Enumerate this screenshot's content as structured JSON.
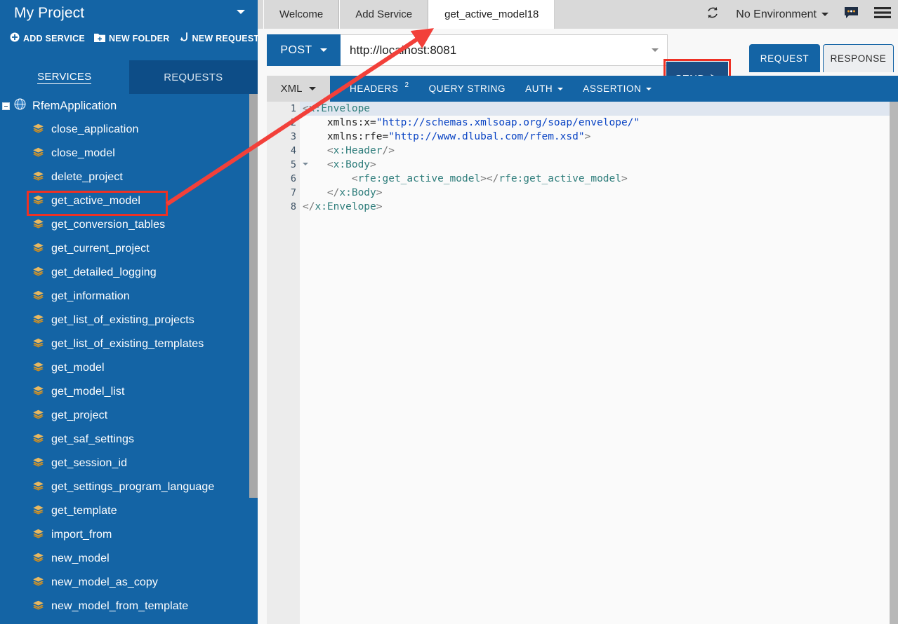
{
  "sidebar": {
    "project_title": "My Project",
    "actions": [
      {
        "label": "ADD SERVICE",
        "icon": "plus-circle-icon"
      },
      {
        "label": "NEW FOLDER",
        "icon": "folder-plus-icon"
      },
      {
        "label": "NEW REQUEST",
        "icon": "new-request-icon"
      }
    ],
    "tabs": [
      {
        "label": "SERVICES",
        "active": true
      },
      {
        "label": "REQUESTS",
        "active": false
      }
    ],
    "tree_root": {
      "label": "RfemApplication",
      "icon": "globe-icon",
      "expanded": true
    },
    "items": [
      {
        "label": "close_application"
      },
      {
        "label": "close_model"
      },
      {
        "label": "delete_project"
      },
      {
        "label": "get_active_model",
        "highlighted": true
      },
      {
        "label": "get_conversion_tables"
      },
      {
        "label": "get_current_project"
      },
      {
        "label": "get_detailed_logging"
      },
      {
        "label": "get_information"
      },
      {
        "label": "get_list_of_existing_projects"
      },
      {
        "label": "get_list_of_existing_templates"
      },
      {
        "label": "get_model"
      },
      {
        "label": "get_model_list"
      },
      {
        "label": "get_project"
      },
      {
        "label": "get_saf_settings"
      },
      {
        "label": "get_session_id"
      },
      {
        "label": "get_settings_program_language"
      },
      {
        "label": "get_template"
      },
      {
        "label": "import_from"
      },
      {
        "label": "new_model"
      },
      {
        "label": "new_model_as_copy"
      },
      {
        "label": "new_model_from_template"
      }
    ]
  },
  "topbar": {
    "tabs": [
      {
        "label": "Welcome",
        "active": false
      },
      {
        "label": "Add Service",
        "active": false
      },
      {
        "label": "get_active_model18",
        "active": true
      }
    ],
    "refresh_icon": "refresh-icon",
    "environment": "No Environment",
    "chat_icon": "chat-bubble-icon",
    "menu_icon": "hamburger-menu-icon"
  },
  "request": {
    "method": "POST",
    "url": "http://localhost:8081",
    "url_placeholder": "http://localhost:8081",
    "send_label": "SEND",
    "send_icon": "send-arrow-icon",
    "rr_tabs": [
      {
        "label": "REQUEST",
        "active": true
      },
      {
        "label": "RESPONSE",
        "active": false
      }
    ],
    "body_tabs": [
      {
        "label": "XML",
        "type": "dropdown",
        "active": true
      },
      {
        "label": "HEADERS",
        "badge": "2",
        "type": "plain",
        "active": false
      },
      {
        "label": "QUERY STRING",
        "type": "plain",
        "active": false
      },
      {
        "label": "AUTH",
        "type": "dropdown",
        "active": false
      },
      {
        "label": "ASSERTION",
        "type": "dropdown",
        "active": false
      }
    ]
  },
  "editor": {
    "line_numbers": [
      "1",
      "2",
      "3",
      "4",
      "5",
      "6",
      "7",
      "8"
    ],
    "fold_lines": [
      "1",
      "5"
    ],
    "lines": [
      "<x:Envelope",
      "    xmlns:x=\"http://schemas.xmlsoap.org/soap/envelope/\"",
      "    xmlns:rfe=\"http://www.dlubal.com/rfem.xsd\">",
      "    <x:Header/>",
      "    <x:Body>",
      "        <rfe:get_active_model></rfe:get_active_model>",
      "    </x:Body>",
      "</x:Envelope>"
    ]
  },
  "annotation": {
    "arrow_color": "#ee3124",
    "highlight_color": "#ee3124"
  },
  "colors": {
    "sidebar_blue": "#1464a5",
    "sidebar_tab_inactive": "#0d4d87",
    "send_navy": "#1b4f85",
    "topbar_gray": "#d9d9d9",
    "accent_red": "#ee3124",
    "tree_icon_gold": "#e0a33c"
  }
}
